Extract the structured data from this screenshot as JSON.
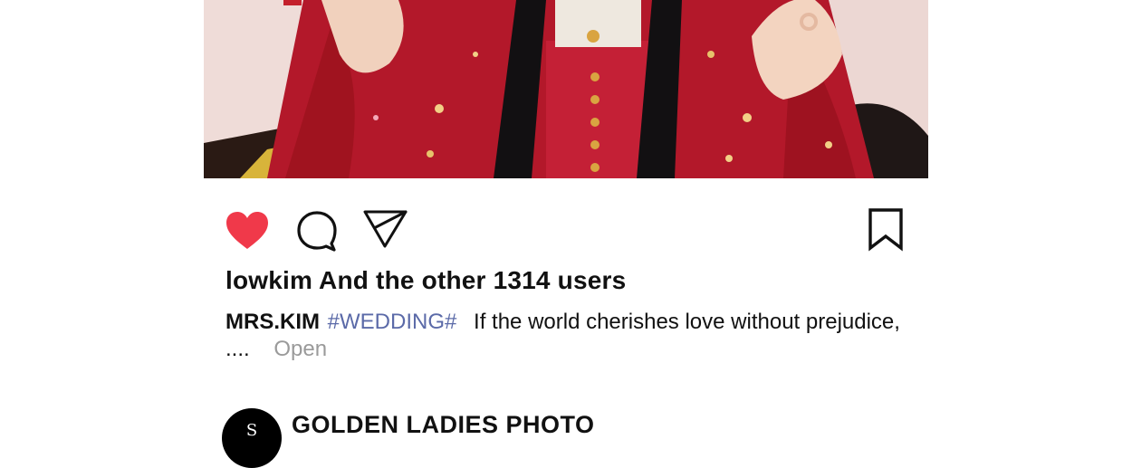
{
  "post": {
    "likes_text": "lowkim And the other 1314 users",
    "caption": {
      "username": "MRS.KIM",
      "hashtag": "#WEDDING#",
      "text": "If the world cherishes love without prejudice, ....",
      "open_label": "Open"
    }
  },
  "next_post": {
    "avatar_glyph": "S",
    "account_name": "GOLDEN LADIES PHOTO"
  },
  "icons": {
    "like": "heart-icon",
    "comment": "speech-bubble-icon",
    "share": "paper-plane-icon",
    "save": "bookmark-icon"
  },
  "colors": {
    "like_active": "#f0394a",
    "hashtag": "#5b6aa8",
    "open_link": "#9a9a9a",
    "robe_red": "#b91c2c",
    "background": "#ffffff"
  }
}
